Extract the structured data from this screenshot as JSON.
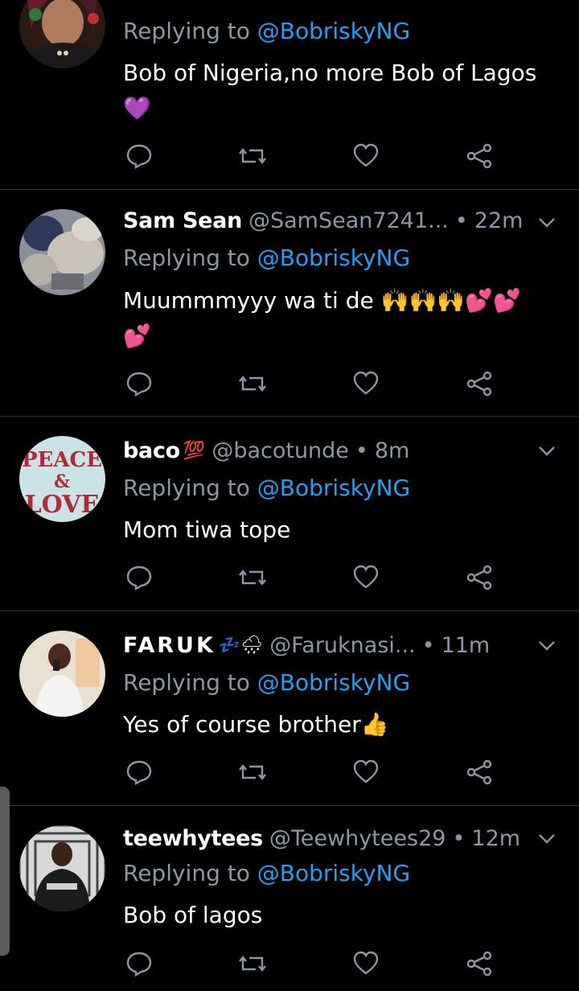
{
  "tweets": [
    {
      "display_name": "",
      "name_emoji": "",
      "handle": "",
      "time": "",
      "replying_prefix": "Replying to ",
      "replying_mention": "@BobriskyNG",
      "text_lines": [
        "Bob of Nigeria,no more Bob of Lagos",
        "💜"
      ]
    },
    {
      "display_name": "Sam Sean",
      "name_emoji": "",
      "handle": "@SamSean7241...",
      "dot": "•",
      "time": "22m",
      "replying_prefix": "Replying to ",
      "replying_mention": "@BobriskyNG",
      "text_lines": [
        "Muummmyyy wa ti de 🙌🙌🙌💕💕",
        "💕"
      ]
    },
    {
      "display_name": "baco",
      "name_emoji": "💯",
      "handle": "@bacotunde",
      "dot": "•",
      "time": "8m",
      "replying_prefix": "Replying to ",
      "replying_mention": "@BobriskyNG",
      "text_lines": [
        "Mom tiwa tope"
      ]
    },
    {
      "display_name": "FARUK",
      "name_emoji": "💤🌧",
      "handle": "@Faruknasi...",
      "dot": "•",
      "time": "11m",
      "replying_prefix": "Replying to ",
      "replying_mention": "@BobriskyNG",
      "text_lines": [
        "Yes of course brother👍"
      ]
    },
    {
      "display_name": "teewhytees",
      "name_emoji": "",
      "handle": "@Teewhytees29",
      "dot": "•",
      "time": "12m",
      "replying_prefix": "Replying to ",
      "replying_mention": "@BobriskyNG",
      "text_lines": [
        "Bob of lagos"
      ]
    }
  ],
  "avatar_text": {
    "peace": "PEACE",
    "amp": "&",
    "love": "LOVE"
  },
  "actions": [
    "reply-icon",
    "retweet-icon",
    "like-icon",
    "share-icon"
  ],
  "colors": {
    "background": "#000000",
    "text": "#ffffff",
    "muted": "#8899a6",
    "mention": "#1da1f2",
    "divider": "#2f3336"
  }
}
